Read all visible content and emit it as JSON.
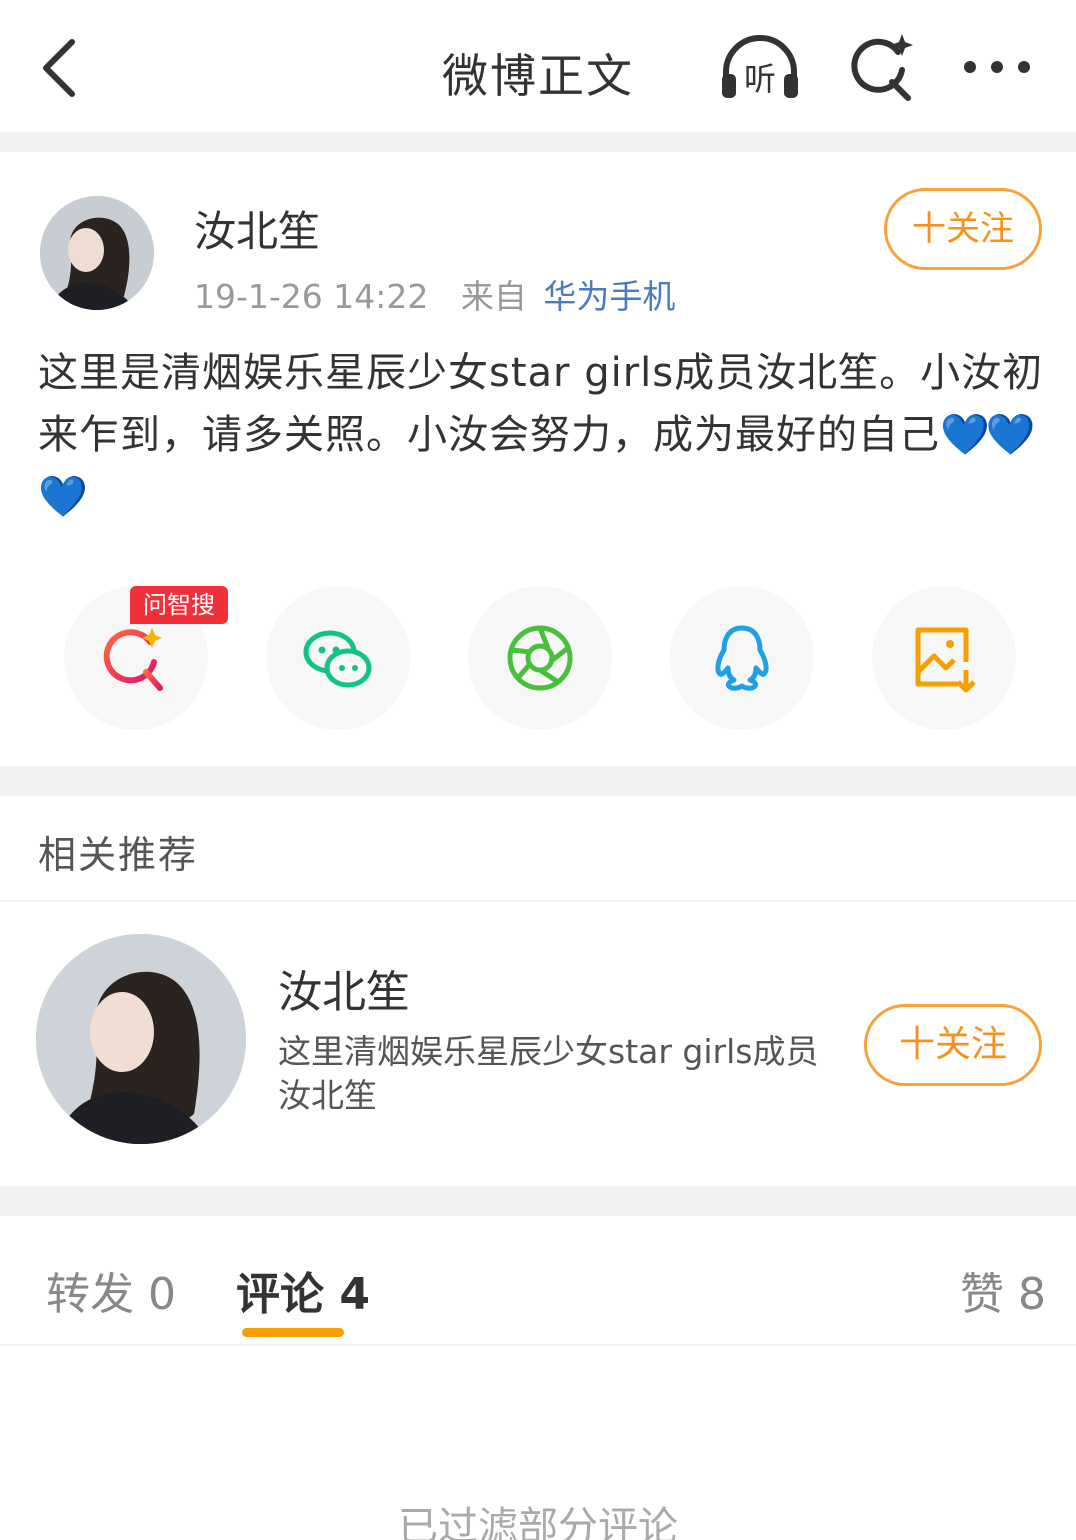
{
  "header": {
    "title": "微博正文",
    "icons": [
      "back-arrow-icon",
      "listen-headphones-icon",
      "smart-search-icon",
      "more-icon"
    ],
    "listen_label": "听"
  },
  "post": {
    "username": "汝北笙",
    "time": "19-1-26 14:22",
    "from_label": "来自",
    "source": "华为手机",
    "follow_label": "十关注",
    "text": "这里是清烟娱乐星辰少女star girls成员汝北笙。小汝初来乍到，请多关照。小汝会努力，成为最好的自己",
    "hearts": "💙💙💙"
  },
  "share": {
    "badge": "问智搜",
    "buttons": [
      "smart-search-icon",
      "wechat-icon",
      "moments-icon",
      "qq-icon",
      "save-image-icon"
    ]
  },
  "recommend": {
    "title": "相关推荐",
    "name": "汝北笙",
    "desc": "这里清烟娱乐星辰少女star girls成员汝北笙",
    "follow_label": "十关注"
  },
  "tabs": [
    {
      "label": "转发 0",
      "active": false
    },
    {
      "label": "评论 4",
      "active": true
    },
    {
      "label": "赞 8",
      "active": false
    }
  ],
  "footer": {
    "filtered_text": "已过滤部分评论"
  },
  "colors": {
    "accent": "#f7911b",
    "link": "#4a7bbf",
    "tab_underline": "#f7a000",
    "badge": "#f0303a"
  }
}
